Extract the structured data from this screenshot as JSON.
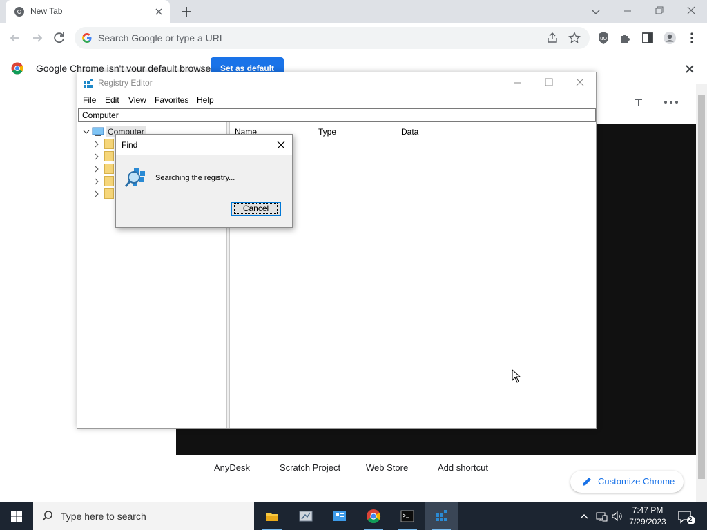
{
  "chrome": {
    "tab": {
      "title": "New Tab"
    },
    "omnibox": {
      "placeholder": "Search Google or type a URL"
    },
    "infobar": {
      "message": "Google Chrome isn't your default browser",
      "button": "Set as default"
    },
    "ntp": {
      "shortcuts": [
        "AnyDesk",
        "Scratch Project",
        "Web Store",
        "Add shortcut"
      ],
      "customize": "Customize Chrome"
    }
  },
  "regedit": {
    "title": "Registry Editor",
    "menu": [
      "File",
      "Edit",
      "View",
      "Favorites",
      "Help"
    ],
    "address": "Computer",
    "tree_root": "Computer",
    "columns": [
      "Name",
      "Type",
      "Data"
    ]
  },
  "find_dialog": {
    "title": "Find",
    "message": "Searching the registry...",
    "cancel": "Cancel"
  },
  "taskbar": {
    "search_placeholder": "Type here to search",
    "time": "7:47 PM",
    "date": "7/29/2023",
    "notification_count": "2"
  },
  "colors": {
    "accent": "#1a73e8",
    "taskbar": "#1c2531",
    "focus_border": "#0078d7"
  }
}
